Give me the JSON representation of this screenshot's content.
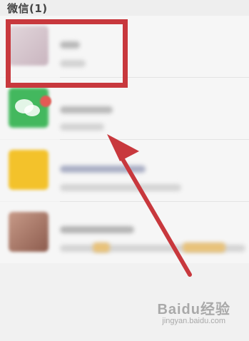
{
  "header": {
    "title": "微信(1)"
  },
  "chat_list": [
    {
      "name": "",
      "preview": "",
      "avatar_color": "#d7c7cf"
    },
    {
      "name": "",
      "preview": "",
      "avatar_color": "#43b85e",
      "unread": true
    },
    {
      "name": "",
      "preview": "",
      "avatar_color": "#f3c22b"
    },
    {
      "name": "",
      "preview": "",
      "avatar_color": "#b07a67"
    }
  ],
  "annotation": {
    "box_color": "#c8383d",
    "arrow_color": "#c8383d"
  },
  "watermark": {
    "logo": "Baidu经验",
    "sub": "jingyan.baidu.com"
  }
}
